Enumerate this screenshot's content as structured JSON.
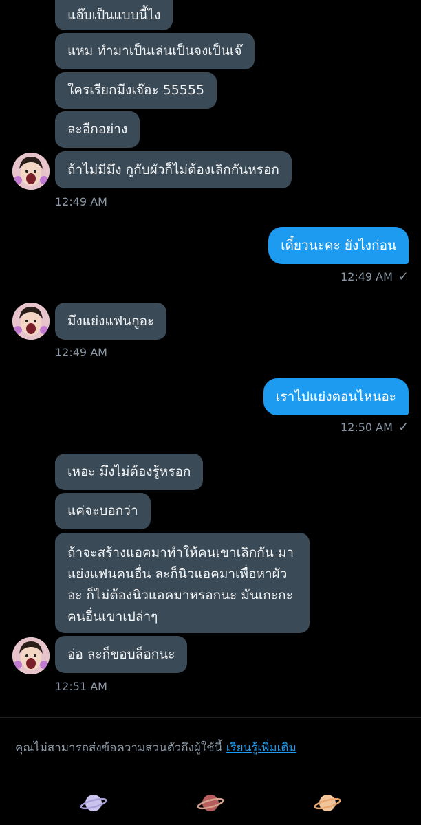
{
  "messages": {
    "m1": "แอ๊บเป็นแบบนี้ไง",
    "m2": "แหม ทำมาเป็นเล่นเป็นจงเป็นเจ๊",
    "m3": "ใครเรียกมึงเจ๊อะ 55555",
    "m4": "ละอีกอย่าง",
    "m5": "ถ้าไม่มีมึง กูกับผัวก็ไม่ต้องเลิกกันหรอก",
    "t1": "12:49 AM",
    "o1": "เดี๋ยวนะคะ ยังไงก่อน",
    "t2": "12:49 AM",
    "m6": "มึงแย่งแฟนกูอะ",
    "t3": "12:49 AM",
    "o2": "เราไปแย่งตอนไหนอะ",
    "t4": "12:50 AM",
    "m7": "เหอะ มึงไม่ต้องรู้หรอก",
    "m8": "แค่จะบอกว่า",
    "m9": "ถ้าจะสร้างแอคมาทำให้คนเขาเลิกกัน มา แย่งแฟนคนอื่น ละก็นิวแอคมาเพื่อหาผัว อะ ก็ไม่ต้องนิวแอคมาหรอกนะ มันเกะกะ คนอื่นเขาเปล่าๆ",
    "m10": "อ่อ ละก็ขอบล็อกนะ",
    "t5": "12:51 AM"
  },
  "footer": {
    "notice": "คุณไม่สามารถส่งข้อความส่วนตัวถึงผู้ใช้นี้",
    "learn_more": "เรียนรู้เพิ่มเติม"
  },
  "colors": {
    "incoming_bubble": "#3b4a57",
    "outgoing_bubble": "#1d9bf0",
    "timestamp": "#8b98a5",
    "background": "#000000"
  },
  "icons": {
    "read_receipt": "check-icon",
    "planet_1": "planet-lavender-icon",
    "planet_2": "planet-red-icon",
    "planet_3": "planet-peach-icon"
  }
}
